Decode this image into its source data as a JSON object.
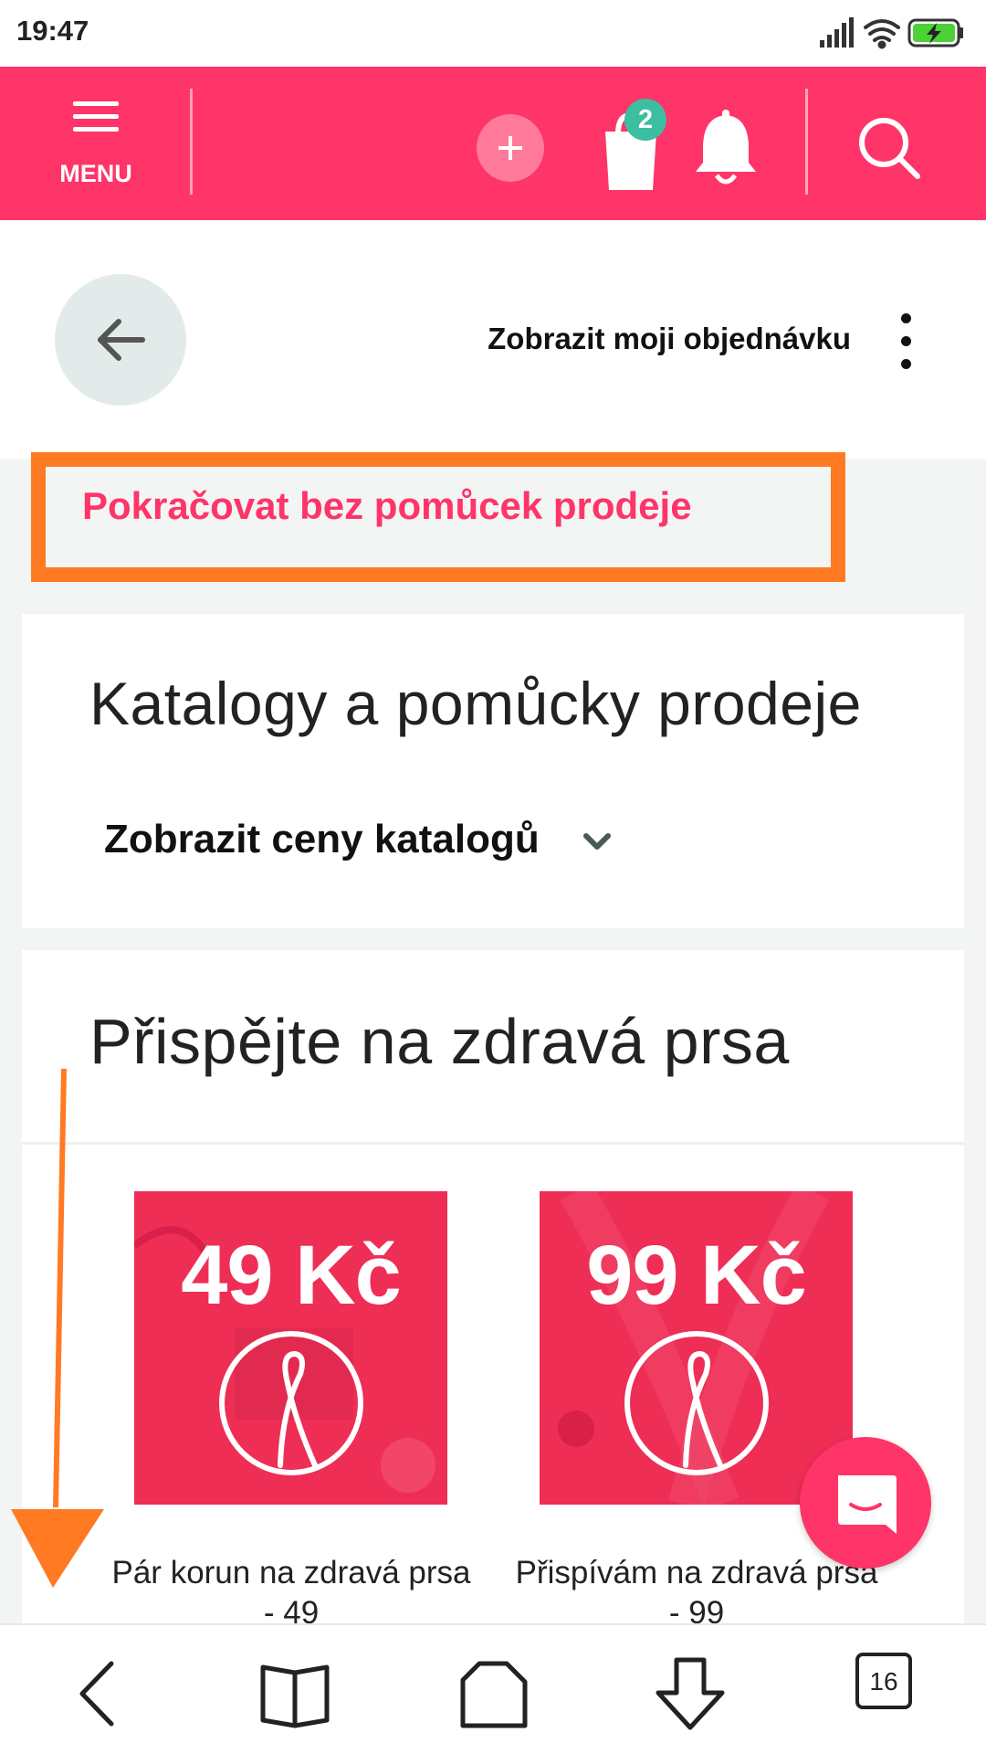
{
  "status_bar": {
    "time": "19:47"
  },
  "header": {
    "menu_label": "MENU",
    "cart_count": "2"
  },
  "subheader": {
    "view_order_label": "Zobrazit moji objednávku"
  },
  "continue_link": "Pokračovat bez pomůcek prodeje",
  "catalog_card": {
    "title": "Katalogy a pomůcky prodeje",
    "price_toggle_label": "Zobrazit ceny katalogů"
  },
  "donation_card": {
    "title": "Přispějte na zdravá prsa",
    "products": [
      {
        "price_label": "49 Kč",
        "name": "Pár korun na zdravá prsa - 49"
      },
      {
        "price_label": "99 Kč",
        "name": "Přispívám na zdravá prsa - 99"
      }
    ]
  },
  "bottom_nav": {
    "tabs_count": "16"
  },
  "colors": {
    "brand": "#ff3468",
    "annotation": "#ff7a22",
    "badge": "#3cbfa0"
  }
}
